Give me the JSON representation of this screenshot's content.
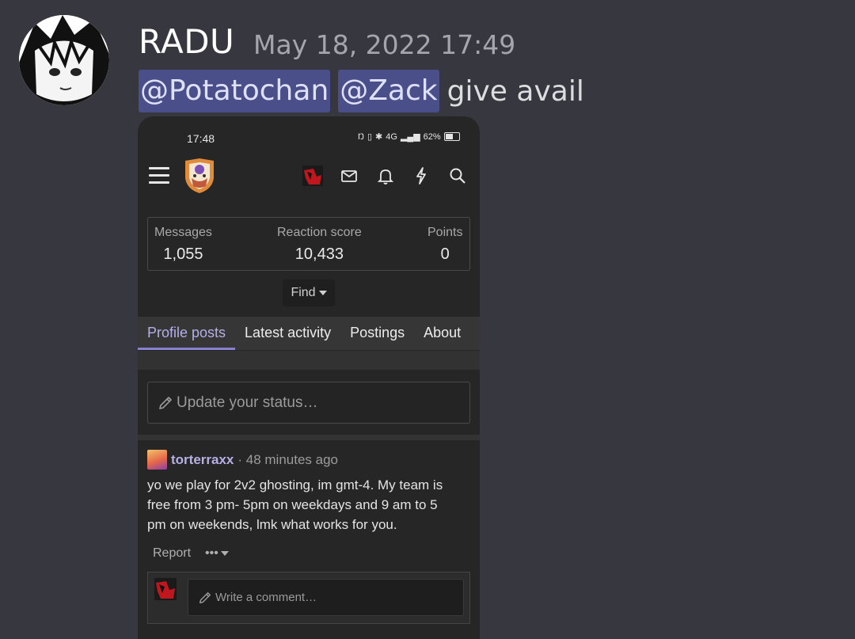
{
  "message": {
    "author": "RADU",
    "timestamp": "May 18, 2022 17:49",
    "mentions": [
      "@Potatochan",
      "@Zack"
    ],
    "text": "give avail"
  },
  "phone": {
    "status_bar": {
      "time": "17:48",
      "network": "4G",
      "battery": "62%"
    },
    "stats": {
      "messages_label": "Messages",
      "messages_value": "1,055",
      "reaction_label": "Reaction score",
      "reaction_value": "10,433",
      "points_label": "Points",
      "points_value": "0"
    },
    "find_label": "Find",
    "tabs": [
      {
        "label": "Profile posts",
        "active": true
      },
      {
        "label": "Latest activity",
        "active": false
      },
      {
        "label": "Postings",
        "active": false
      },
      {
        "label": "About",
        "active": false
      }
    ],
    "status_placeholder": "Update your status…",
    "post": {
      "author": "torterraxx",
      "time": "· 48 minutes ago",
      "lines": [
        "yo we play for 2v2 ghosting, im gmt-4. My team is",
        "free from 3 pm- 5pm on weekdays and 9 am to 5",
        "pm on weekends, lmk what works for you."
      ],
      "report_label": "Report",
      "more_label": "•••"
    },
    "comment_placeholder": "Write a comment…"
  },
  "colors": {
    "background": "#37383f",
    "mention_bg": "#4a4f8a",
    "accent": "#b5aee8"
  },
  "icons": [
    "hamburger-icon",
    "site-logo",
    "mail-icon",
    "bell-icon",
    "bolt-icon",
    "search-icon",
    "pencil-icon",
    "caret-down-icon"
  ]
}
